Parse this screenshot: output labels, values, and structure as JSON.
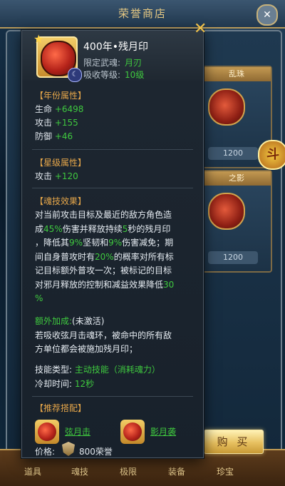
{
  "background": {
    "title": "荣誉商店",
    "slots": [
      {
        "head": "乱珠",
        "price": "1200"
      },
      {
        "head": "之影",
        "price": "1200"
      }
    ],
    "tabs": [
      "道具",
      "魂技",
      "极限",
      "装备",
      "珍宝"
    ],
    "badge": "斗"
  },
  "buy_button": "购 买",
  "tooltip": {
    "item_name": "400年•残月印",
    "limit_label": "限定武魂:",
    "limit_value": "月刃",
    "absorb_label": "吸收等级:",
    "absorb_value": "10级",
    "year_attr": {
      "title": "【年份属性】",
      "rows": [
        {
          "label": "生命",
          "value": "+6498"
        },
        {
          "label": "攻击",
          "value": "+155"
        },
        {
          "label": "防御",
          "value": "+46"
        }
      ]
    },
    "star_attr": {
      "title": "【星级属性】",
      "rows": [
        {
          "label": "攻击",
          "value": "+120"
        }
      ]
    },
    "skill": {
      "title": "【魂技效果】",
      "lines": [
        [
          "对当前攻击目标及最近的敌方角色造"
        ],
        [
          "成",
          "45%",
          "伤害并释放持续",
          "5",
          "秒的残月印"
        ],
        [
          "，降低其",
          "9%",
          "坚韧和",
          "9%",
          "伤害减免；期"
        ],
        [
          "间自身普攻时有",
          "20%",
          "的概率对所有标"
        ],
        [
          "记目标额外普攻一次；被标记的目标"
        ],
        [
          "对邪月释放的控制和减益效果降低",
          "30"
        ],
        [
          "%"
        ]
      ],
      "extra_title": "额外加成:",
      "extra_status": "(未激活)",
      "extra_lines": [
        "若吸收弦月击魂环，被命中的所有敌",
        "方单位都会被施加残月印；"
      ],
      "type_label": "技能类型:",
      "type_value": "主动技能（消耗魂力）",
      "cd_label": "冷却时间:",
      "cd_value": "12秒"
    },
    "recommend": {
      "title": "【推荐搭配】",
      "items": [
        "弦月击",
        "影月袭"
      ]
    },
    "price_label": "价格:",
    "price_value": "800荣誉"
  }
}
